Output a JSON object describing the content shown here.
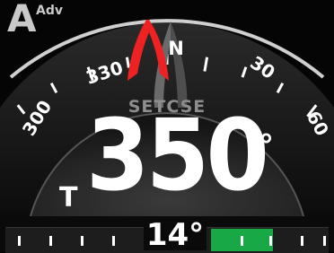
{
  "autopilot": {
    "mode_letter": "A",
    "mode_sub": "Adv"
  },
  "compass": {
    "north_label": "N",
    "labels": [
      "300",
      "330",
      "30",
      "60"
    ],
    "heading_degrees": 350,
    "colors": {
      "north_pointer": "#ee2222",
      "arc": "#cfcfcf"
    }
  },
  "course": {
    "source_label": "SETCSE",
    "value": "350",
    "unit": "°",
    "reference": "T"
  },
  "cross_track": {
    "value": "14°",
    "fill_fraction": 0.4,
    "fill_color": "#18a845"
  }
}
